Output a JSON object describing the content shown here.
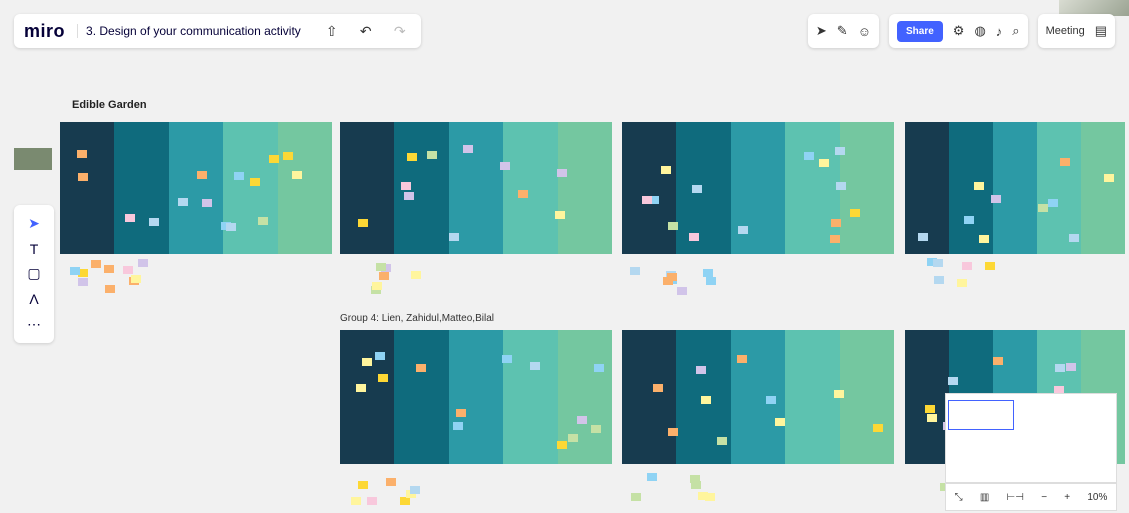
{
  "header": {
    "logo": "miro",
    "board_title": "3. Design of your communication activity"
  },
  "toolbar_right": {
    "share_label": "Share",
    "meeting_label": "Meeting"
  },
  "left_tools": [
    "cursor-icon",
    "text-icon",
    "sticky-note-icon",
    "pen-icon",
    "more-icon"
  ],
  "canvas": {
    "title": "Edible Garden",
    "group4_label": "Group 4: Lien, Zahidul,Matteo,Bilal"
  },
  "zoom": {
    "level": "10%"
  },
  "colors": {
    "navy": "#173b4f",
    "teal_dark": "#0f6b7d",
    "teal": "#2c9aa6",
    "teal_light": "#5dc2b0",
    "green": "#74c7a0",
    "accent": "#4262ff"
  }
}
